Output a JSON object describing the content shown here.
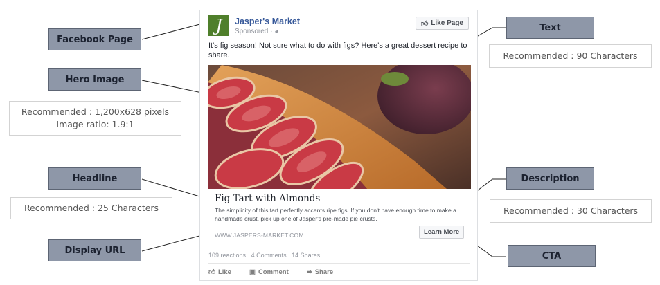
{
  "labels": {
    "facebook_page": "Facebook Page",
    "hero_image": "Hero Image",
    "headline": "Headline",
    "display_url": "Display URL",
    "text": "Text",
    "description": "Description",
    "cta": "CTA"
  },
  "notes": {
    "hero_line1": "Recommended : 1,200x628 pixels",
    "hero_line2": "Image ratio: 1.9:1",
    "headline": "Recommended :  25 Characters",
    "text": "Recommended :  90 Characters",
    "description": "Recommended :  30 Characters"
  },
  "ad": {
    "logo_letter": "J",
    "page_name": "Jasper's Market",
    "sponsored": "Sponsored · ",
    "like_page": "Like Page",
    "post_text": "It's fig season! Not sure what to do with figs? Here's a great dessert recipe to share.",
    "headline": "Fig Tart with Almonds",
    "description": "The simplicity of this tart perfectly accents ripe figs. If you don't have enough time to make a handmade crust, pick up one of Jasper's pre-made pie crusts.",
    "display_url": "WWW.JASPERS-MARKET.COM",
    "cta": "Learn More",
    "reactions": "109 reactions",
    "comments": "4 Comments",
    "shares": "14 Shares",
    "action_like": "Like",
    "action_comment": "Comment",
    "action_share": "Share"
  },
  "colors": {
    "label_fill": "#8e97a8",
    "link_blue": "#365899"
  }
}
